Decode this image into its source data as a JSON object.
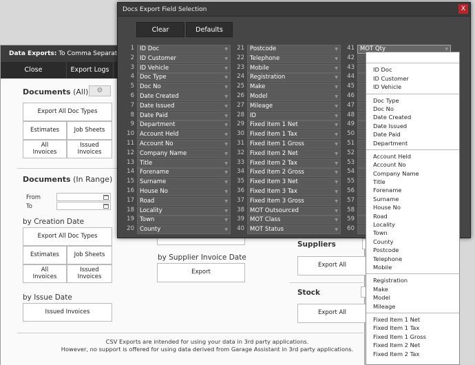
{
  "bg_window": {
    "title_bold": "Data Exports:",
    "title_rest": " To Comma Separated",
    "toolbar": [
      "Close",
      "Export Logs"
    ],
    "documents_all": {
      "title": "Documents",
      "suffix": " (All)",
      "export_all": "Export All Doc Types",
      "estimates": "Estimates",
      "job_sheets": "Job Sheets",
      "all_invoices": "All\nInvoices",
      "issued_invoices": "Issued\nInvoices"
    },
    "documents_range": {
      "title": "Documents",
      "suffix": " (In Range)",
      "from": "From",
      "to": "To"
    },
    "creation": {
      "title": "by Creation Date",
      "export_all": "Export All Doc Types",
      "estimates": "Estimates",
      "job_sheets": "Job Sheets",
      "all_invoices": "All\nInvoices",
      "issued_invoices": "Issued\nInvoices"
    },
    "issue": {
      "title": "by Issue Date",
      "issued_invoices": "Issued Invoices"
    },
    "supplier_invoice": {
      "title": "by Supplier Invoice Date",
      "export": "Export"
    },
    "suppliers": {
      "title": "Suppliers",
      "export_all": "Export All"
    },
    "stock": {
      "title": "Stock",
      "export_all": "Export All"
    },
    "footer_line1": "CSV Exports are intended for using your data in 3rd party applications.",
    "footer_line2": "However, no support is offered for using data derived from Garage Assistant in 3rd party applications."
  },
  "dialog": {
    "title": "Docs Export Field Selection",
    "close": "X",
    "clear": "Clear",
    "defaults": "Defaults",
    "col1": [
      [
        "1",
        "ID Doc"
      ],
      [
        "2",
        "ID Customer"
      ],
      [
        "3",
        "ID Vehicle"
      ],
      [
        "4",
        "Doc Type"
      ],
      [
        "5",
        "Doc No"
      ],
      [
        "6",
        "Date Created"
      ],
      [
        "7",
        "Date Issued"
      ],
      [
        "8",
        "Date Paid"
      ],
      [
        "9",
        "Department"
      ],
      [
        "10",
        "Account Held"
      ],
      [
        "11",
        "Account No"
      ],
      [
        "12",
        "Company Name"
      ],
      [
        "13",
        "Title"
      ],
      [
        "14",
        "Forename"
      ],
      [
        "15",
        "Surname"
      ],
      [
        "16",
        "House No"
      ],
      [
        "17",
        "Road"
      ],
      [
        "18",
        "Locality"
      ],
      [
        "19",
        "Town"
      ],
      [
        "20",
        "County"
      ]
    ],
    "col2": [
      [
        "21",
        "Postcode"
      ],
      [
        "22",
        "Telephone"
      ],
      [
        "23",
        "Mobile"
      ],
      [
        "24",
        "Registration"
      ],
      [
        "25",
        "Make"
      ],
      [
        "26",
        "Model"
      ],
      [
        "27",
        "Mileage"
      ],
      [
        "28",
        "ID"
      ],
      [
        "29",
        "Fixed Item 1 Net"
      ],
      [
        "30",
        "Fixed Item 1 Tax"
      ],
      [
        "31",
        "Fixed Item 1 Gross"
      ],
      [
        "32",
        "Fixed Item 2 Net"
      ],
      [
        "33",
        "Fixed Item 2 Tax"
      ],
      [
        "34",
        "Fixed Item 2 Gross"
      ],
      [
        "35",
        "Fixed Item 3 Net"
      ],
      [
        "36",
        "Fixed Item 3 Tax"
      ],
      [
        "37",
        "Fixed Item 3 Gross"
      ],
      [
        "38",
        "MOT Outsourced"
      ],
      [
        "39",
        "MOT Class"
      ],
      [
        "40",
        "MOT Status"
      ]
    ],
    "col3": [
      [
        "41",
        "MOT Qty"
      ],
      [
        "42",
        ""
      ],
      [
        "43",
        ""
      ],
      [
        "44",
        ""
      ],
      [
        "45",
        ""
      ],
      [
        "46",
        ""
      ],
      [
        "47",
        ""
      ],
      [
        "48",
        ""
      ],
      [
        "49",
        ""
      ],
      [
        "50",
        ""
      ],
      [
        "51",
        ""
      ],
      [
        "52",
        ""
      ],
      [
        "53",
        ""
      ],
      [
        "54",
        ""
      ],
      [
        "55",
        ""
      ],
      [
        "56",
        ""
      ],
      [
        "57",
        ""
      ],
      [
        "58",
        ""
      ],
      [
        "59",
        ""
      ],
      [
        "60",
        ""
      ]
    ]
  },
  "dropdown": {
    "groups": [
      [
        "ID Doc",
        "ID Customer",
        "ID Vehicle"
      ],
      [
        "Doc Type",
        "Doc No",
        "Date Created",
        "Date Issued",
        "Date Paid",
        "Department"
      ],
      [
        "Account Held",
        "Account No",
        "Company Name",
        "Title",
        "Forename",
        "Surname",
        "House No",
        "Road",
        "Locality",
        "Town",
        "County",
        "Postcode",
        "Telephone",
        "Mobile"
      ],
      [
        "Registration",
        "Make",
        "Model",
        "Mileage"
      ],
      [
        "Fixed Item 1 Net",
        "Fixed Item 1 Tax",
        "Fixed Item 1 Gross",
        "Fixed Item 2 Net",
        "Fixed Item 2 Tax"
      ]
    ]
  }
}
